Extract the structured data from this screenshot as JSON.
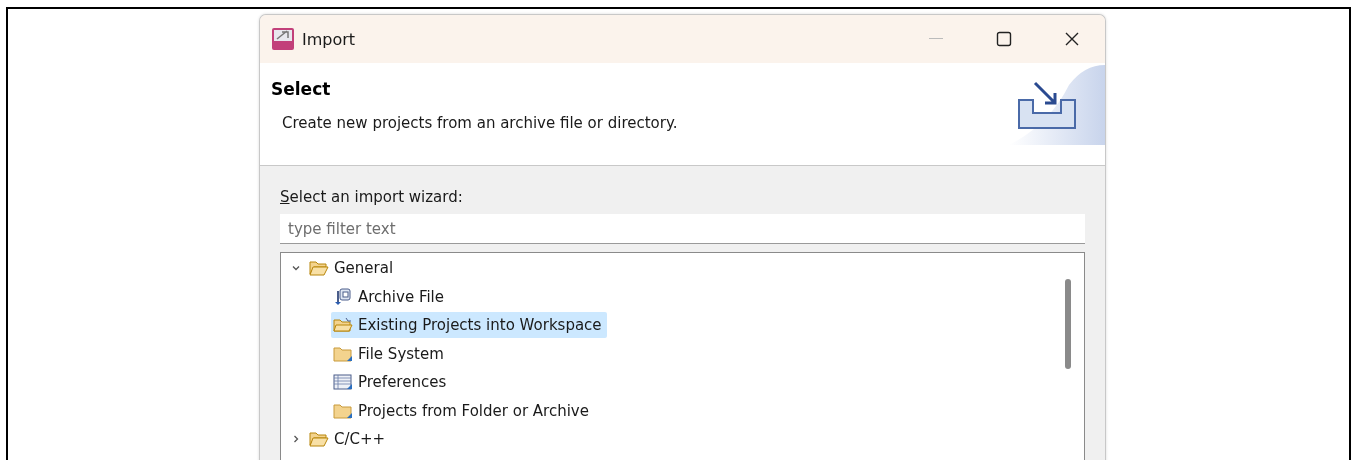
{
  "window": {
    "title": "Import"
  },
  "header": {
    "title": "Select",
    "description": "Create new projects from an archive file or directory."
  },
  "wizard_label": "Select an import wizard:",
  "filter": {
    "placeholder": "type filter text"
  },
  "tree": [
    {
      "label": "General",
      "kind": "category",
      "expanded": true,
      "selected": false,
      "children": [
        {
          "label": "Archive File",
          "kind": "archive",
          "selected": false
        },
        {
          "label": "Existing Projects into Workspace",
          "kind": "project",
          "selected": true
        },
        {
          "label": "File System",
          "kind": "folder",
          "selected": false
        },
        {
          "label": "Preferences",
          "kind": "preferences",
          "selected": false
        },
        {
          "label": "Projects from Folder or Archive",
          "kind": "folder",
          "selected": false
        }
      ]
    },
    {
      "label": "C/C++",
      "kind": "category",
      "expanded": false,
      "selected": false
    }
  ]
}
